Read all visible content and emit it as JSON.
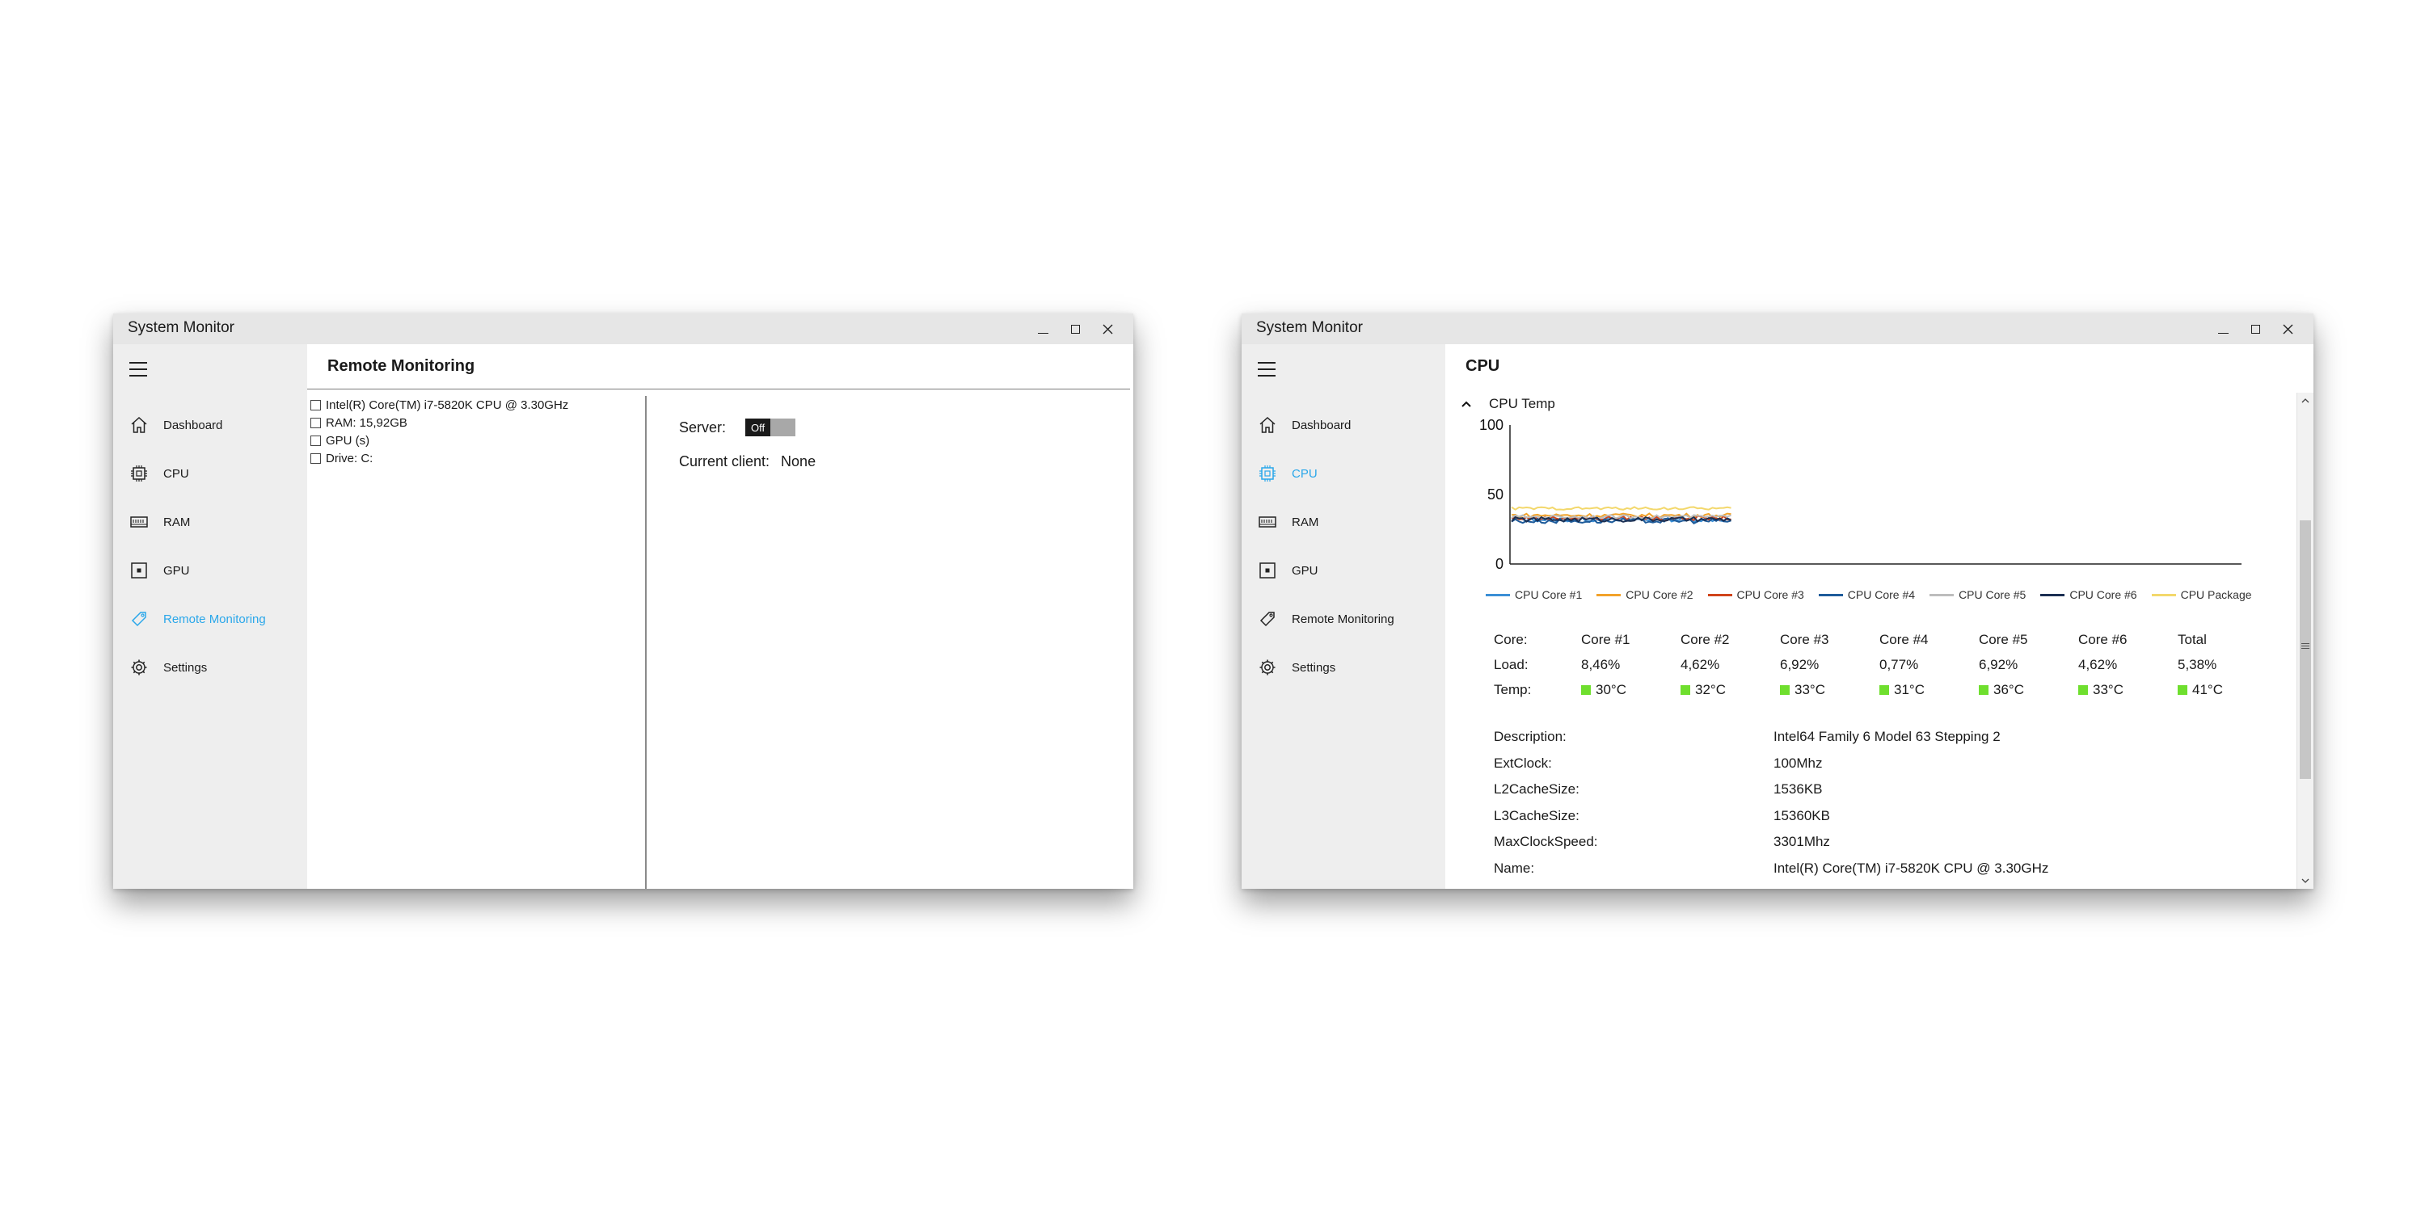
{
  "windows": [
    {
      "title": "System Monitor",
      "page_title": "Remote Monitoring",
      "nav": [
        {
          "label": "Dashboard",
          "icon": "home-icon"
        },
        {
          "label": "CPU",
          "icon": "cpu-icon"
        },
        {
          "label": "RAM",
          "icon": "ram-icon"
        },
        {
          "label": "GPU",
          "icon": "gpu-icon"
        },
        {
          "label": "Remote Monitoring",
          "icon": "tag-icon",
          "active": true
        },
        {
          "label": "Settings",
          "icon": "gear-icon"
        }
      ],
      "devices": [
        "Intel(R) Core(TM) i7-5820K CPU @ 3.30GHz",
        "RAM: 15,92GB",
        "GPU (s)",
        "Drive: C:"
      ],
      "server_label": "Server:",
      "server_toggle": "Off",
      "client_label": "Current client:",
      "client_value": "None"
    },
    {
      "title": "System Monitor",
      "page_title": "CPU",
      "nav": [
        {
          "label": "Dashboard",
          "icon": "home-icon"
        },
        {
          "label": "CPU",
          "icon": "cpu-icon",
          "active": true
        },
        {
          "label": "RAM",
          "icon": "ram-icon"
        },
        {
          "label": "GPU",
          "icon": "gpu-icon"
        },
        {
          "label": "Remote Monitoring",
          "icon": "tag-icon"
        },
        {
          "label": "Settings",
          "icon": "gear-icon"
        }
      ],
      "section_title": "CPU Temp",
      "cores": {
        "headers": [
          "Core:",
          "Core #1",
          "Core #2",
          "Core #3",
          "Core #4",
          "Core #5",
          "Core #6",
          "Total"
        ],
        "load_label": "Load:",
        "loads": [
          "8,46%",
          "4,62%",
          "6,92%",
          "0,77%",
          "6,92%",
          "4,62%",
          "5,38%"
        ],
        "temp_label": "Temp:",
        "temps": [
          "30°C",
          "32°C",
          "33°C",
          "31°C",
          "36°C",
          "33°C",
          "41°C"
        ]
      },
      "details": [
        {
          "key": "Description:",
          "value": "Intel64 Family 6 Model 63 Stepping 2"
        },
        {
          "key": "ExtClock:",
          "value": "100Mhz"
        },
        {
          "key": "L2CacheSize:",
          "value": "1536KB"
        },
        {
          "key": "L3CacheSize:",
          "value": "15360KB"
        },
        {
          "key": "MaxClockSpeed:",
          "value": "3301Mhz"
        },
        {
          "key": "Name:",
          "value": "Intel(R) Core(TM) i7-5820K CPU @ 3.30GHz"
        }
      ]
    }
  ],
  "colors": {
    "accent": "#2aa7ea",
    "temp_indicator": "#6fdf2e"
  },
  "chart_data": {
    "type": "line",
    "title": "CPU Temp",
    "ylim": [
      0,
      100
    ],
    "yticks": [
      "0",
      "50",
      "100"
    ],
    "grid": false,
    "legend_position": "bottom",
    "samples_shown": 60,
    "window_length": 200,
    "series": [
      {
        "name": "CPU Core #1",
        "color": "#3b8fd6",
        "level": 32,
        "amplitude": 1.6
      },
      {
        "name": "CPU Core #2",
        "color": "#f2a22a",
        "level": 35,
        "amplitude": 1.4
      },
      {
        "name": "CPU Core #3",
        "color": "#d0441a",
        "level": 33,
        "amplitude": 1.5
      },
      {
        "name": "CPU Core #4",
        "color": "#1e5b9a",
        "level": 31,
        "amplitude": 1.8
      },
      {
        "name": "CPU Core #5",
        "color": "#bdbdbd",
        "level": 34,
        "amplitude": 1.2
      },
      {
        "name": "CPU Core #6",
        "color": "#1b2f52",
        "level": 32,
        "amplitude": 1.7
      },
      {
        "name": "CPU Package",
        "color": "#f3d86c",
        "level": 40,
        "amplitude": 1.0
      }
    ]
  }
}
